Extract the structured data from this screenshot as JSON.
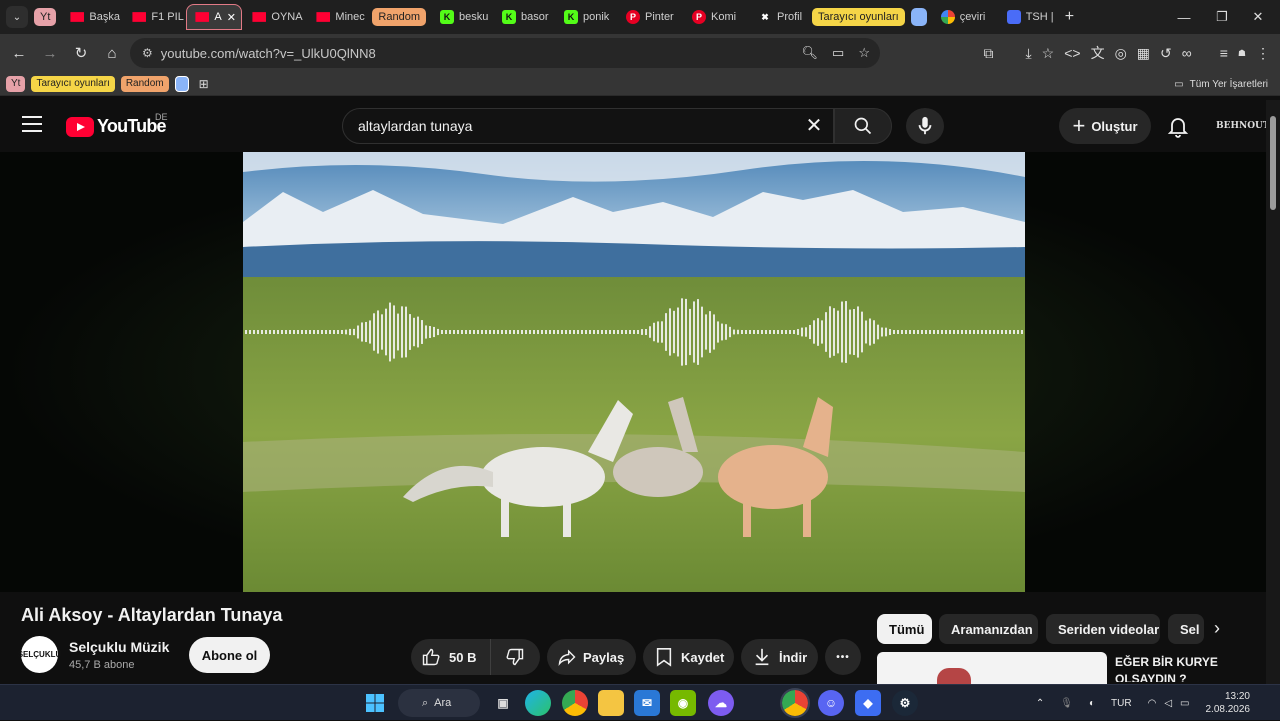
{
  "browser": {
    "tabs": [
      {
        "label": "Yt",
        "kind": "group-chip",
        "color": "#e6a1a8"
      },
      {
        "label": "Başka",
        "icon": "youtube-icon"
      },
      {
        "label": "F1 PIL",
        "icon": "youtube-icon"
      },
      {
        "label": "A",
        "icon": "youtube-icon",
        "active": true
      },
      {
        "label": "OYNA",
        "icon": "youtube-icon"
      },
      {
        "label": "Minec",
        "icon": "youtube-icon"
      },
      {
        "label": "Random",
        "kind": "group-chip",
        "color": "#f0a36b"
      },
      {
        "label": "besku",
        "icon": "kick-icon"
      },
      {
        "label": "basor",
        "icon": "kick-icon"
      },
      {
        "label": "ponik",
        "icon": "kick-icon"
      },
      {
        "label": "Pinter",
        "icon": "pinterest-icon"
      },
      {
        "label": "Komi",
        "icon": "pinterest-icon"
      },
      {
        "label": "Profil",
        "icon": "x-icon"
      },
      {
        "label": "Tarayıcı oyunları",
        "kind": "group-chip",
        "color": "#f5d547"
      },
      {
        "label": "",
        "kind": "group-chip",
        "color": "#8ab4f8"
      },
      {
        "label": "çeviri",
        "icon": "google-icon"
      },
      {
        "label": "TSH |",
        "icon": "tsh-icon"
      }
    ],
    "new_tab": "+",
    "url": "youtube.com/watch?v=_UlkU0QlNN8",
    "bookmarks": [
      {
        "label": "Yt",
        "color": "#e6a1a8"
      },
      {
        "label": "Tarayıcı oyunları",
        "color": "#f5d547"
      },
      {
        "label": "Random",
        "color": "#f0a36b"
      },
      {
        "label": "",
        "color": "#8ab4f8"
      }
    ],
    "all_bookmarks": "Tüm Yer İşaretleri"
  },
  "youtube": {
    "logo_text": "YouTube",
    "region": "DE",
    "search_query": "altaylardan tunaya",
    "create_label": "Oluştur",
    "account_label": "BEHNOUT"
  },
  "video": {
    "title": "Ali Aksoy - Altaylardan Tunaya",
    "channel": {
      "name": "Selçuklu Müzik",
      "subscribers": "45,7 B abone",
      "avatar_text": "SELÇUKLU"
    },
    "subscribe_label": "Abone ol",
    "likes": "50 B",
    "share_label": "Paylaş",
    "save_label": "Kaydet",
    "download_label": "İndir",
    "more_label": "•••"
  },
  "sidebar": {
    "chips": [
      "Tümü",
      "Aramanızdan",
      "Seriden videolar",
      "Sel"
    ],
    "recommendation_title": "EĞER BİR KURYE OLSAYDIN ?"
  },
  "taskbar": {
    "search_label": "Ara",
    "language": "TUR",
    "time": "13:20",
    "date": "2.08.2026"
  }
}
